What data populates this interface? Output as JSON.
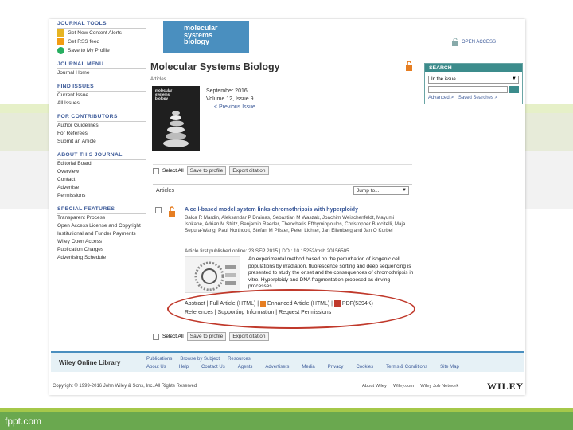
{
  "left": {
    "journal_tools_title": "JOURNAL TOOLS",
    "tools": [
      "Get New Content Alerts",
      "Get RSS feed",
      "Save to My Profile"
    ],
    "journal_menu_title": "JOURNAL MENU",
    "journal_menu_items": [
      "Journal Home"
    ],
    "find_issues_title": "FIND ISSUES",
    "find_issues_items": [
      "Current Issue",
      "All Issues"
    ],
    "contributors_title": "FOR CONTRIBUTORS",
    "contributors_items": [
      "Author Guidelines",
      "For Referees",
      "Submit an Article"
    ],
    "about_title": "ABOUT THIS JOURNAL",
    "about_items": [
      "Editorial Board",
      "Overview",
      "Contact",
      "Advertise",
      "Permissions"
    ],
    "special_title": "SPECIAL FEATURES",
    "special_items": [
      "Transparent Process",
      "Open Access License and Copyright",
      "Institutional and Funder Payments",
      "Wiley Open Access",
      "Publication Charges",
      "Advertising Schedule"
    ]
  },
  "header": {
    "logo_text": [
      "molecular",
      "systems",
      "biology"
    ],
    "open_access": "OPEN ACCESS",
    "journal_title": "Molecular Systems Biology",
    "label": "Articles"
  },
  "search": {
    "heading": "SEARCH",
    "scope": "In the issue",
    "advanced": "Advanced >",
    "saved": "Saved Searches >"
  },
  "issue": {
    "date": "September 2016",
    "volume": "Volume 12, Issue 9",
    "previous": "< Previous Issue",
    "cover_text": [
      "molecular",
      "systems",
      "biology"
    ]
  },
  "toolbar": {
    "select_all": "Select All",
    "save_profile": "Save to profile",
    "export": "Export citation"
  },
  "articles_bar": {
    "label": "Articles",
    "jump": "Jump to..."
  },
  "article": {
    "title": "A cell-based model system links chromothripsis with hyperploidy",
    "authors": "Balca R Mardin, Aleksandar P Drainas, Sebastian M Waszak, Joachim Weischenfeldt, Mayumi Isokane, Adrian M Stütz, Benjamin Raeder, Theocharis Efthymiopoulos, Christopher Buccitelli, Maja Segura-Wang, Paul Northcott, Stefan M Pfister, Peter Lichter, Jan Ellenberg and Jan O Korbel",
    "published": "Article first published online: 23 SEP 2015 | DOI: 10.15252/msb.20156505",
    "abstract": "An experimental method based on the perturbation of isogenic cell populations by irradiation, fluorescence sorting and deep sequencing is presented to study the onset and the consequences of chromothripsis in vitro. Hyperploidy and DNA fragmentation proposed as driving processes.",
    "links_line1": [
      "Abstract",
      "Full Article (HTML)",
      "Enhanced Article (HTML)",
      "PDF(5394K)"
    ],
    "links_line2": [
      "References",
      "Supporting Information",
      "Request Permissions"
    ]
  },
  "footer": {
    "wol": "Wiley Online Library",
    "links_row1": [
      "Publications",
      "Browse by Subject",
      "Resources"
    ],
    "links_row2": [
      "About Us",
      "Help",
      "Contact Us",
      "Agents",
      "Advertisers",
      "Media",
      "Privacy",
      "Cookies",
      "Terms & Conditions",
      "Site Map"
    ],
    "copyright": "Copyright © 1999-2016 John Wiley & Sons, Inc. All Rights Reserved",
    "bottom_links": [
      "About Wiley",
      "Wiley.com",
      "Wiley Job Network"
    ],
    "wiley_logo": "WILEY"
  },
  "watermark": "fppt.com",
  "colors": {
    "accent": "#3b5998",
    "teal": "#3c8c8c",
    "highlight": "#c0392b"
  }
}
